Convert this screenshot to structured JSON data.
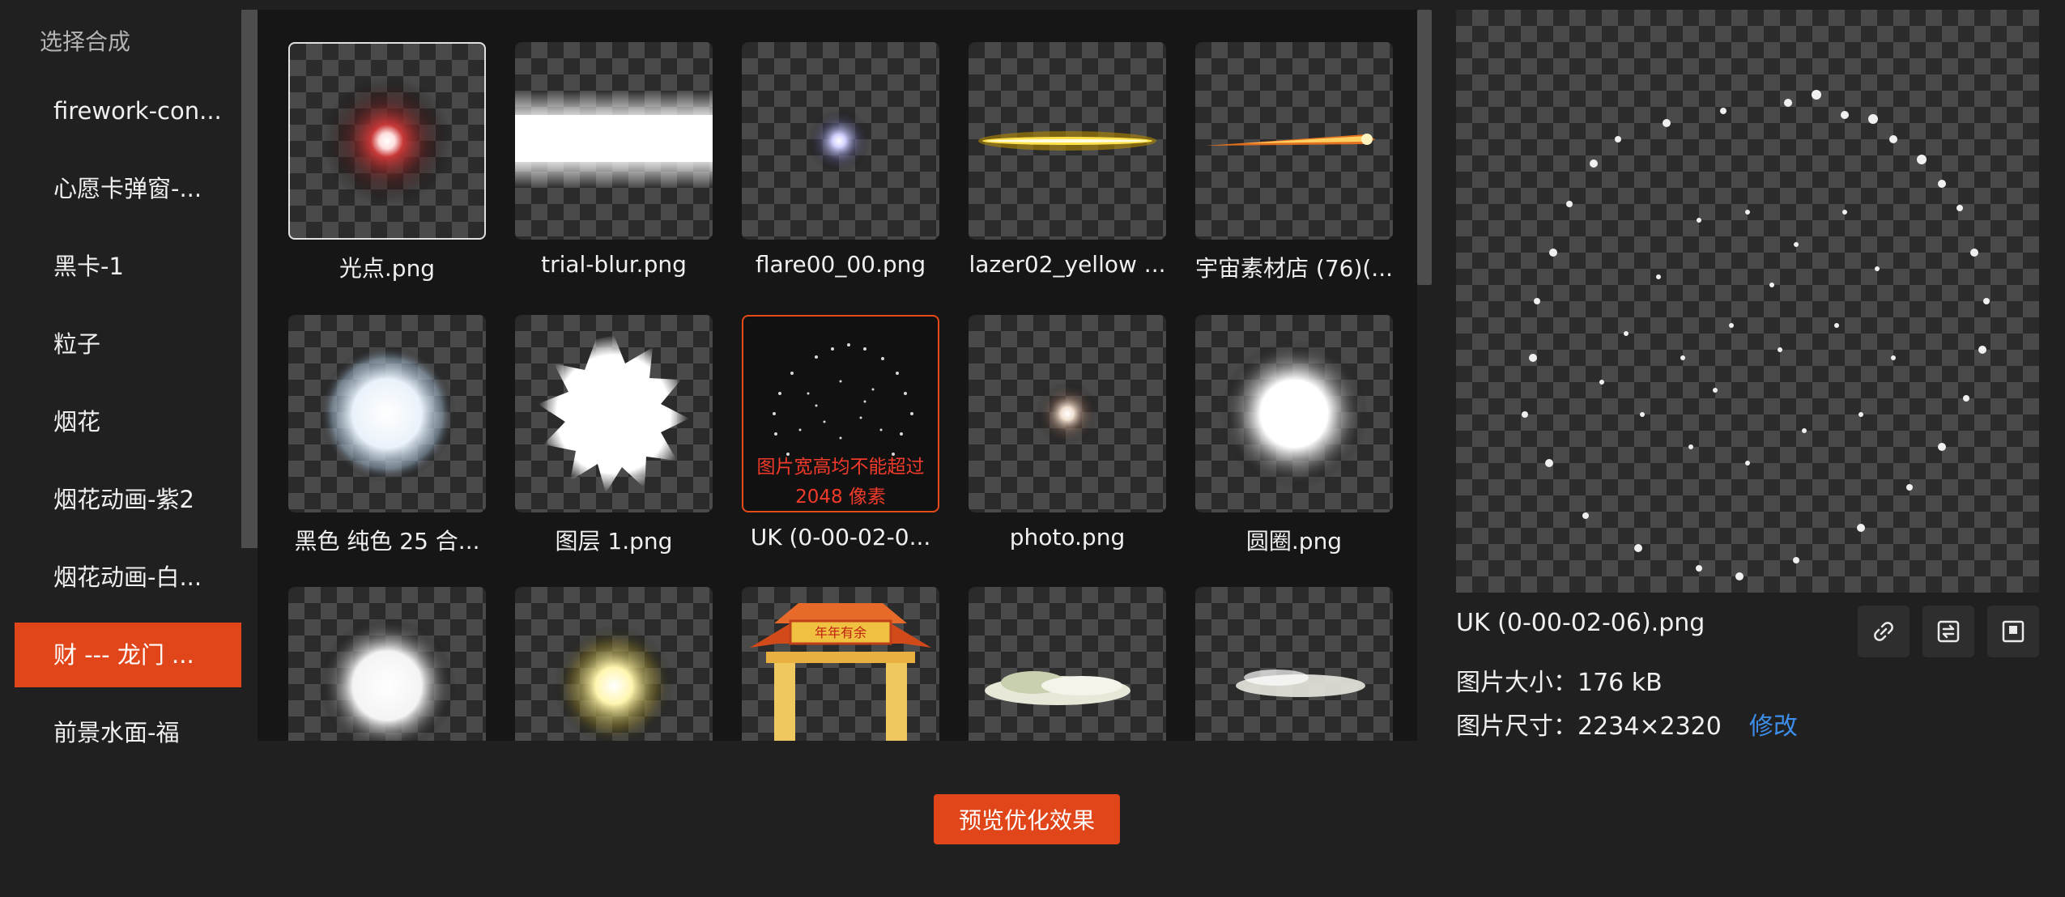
{
  "sidebar": {
    "title": "选择合成",
    "items": [
      {
        "label": "firework-con..."
      },
      {
        "label": "心愿卡弹窗-..."
      },
      {
        "label": "黑卡-1"
      },
      {
        "label": "粒子"
      },
      {
        "label": "烟花"
      },
      {
        "label": "烟花动画-紫2"
      },
      {
        "label": "烟花动画-白..."
      },
      {
        "label": "财 --- 龙门 ..."
      },
      {
        "label": "前景水面-福"
      }
    ]
  },
  "grid": {
    "tiles": [
      {
        "caption": "光点.png"
      },
      {
        "caption": "trial-blur.png"
      },
      {
        "caption": "flare00_00.png"
      },
      {
        "caption": "lazer02_yellow ..."
      },
      {
        "caption": "宇宙素材店 (76)(..."
      },
      {
        "caption": "黑色 纯色 25 合..."
      },
      {
        "caption": "图层 1.png"
      },
      {
        "caption": "UK (0-00-02-0...",
        "warning": "图片宽高均不能超过 2048 像素"
      },
      {
        "caption": "photo.png"
      },
      {
        "caption": "圆圈.png"
      },
      {
        "caption": ""
      },
      {
        "caption": ""
      },
      {
        "caption": "",
        "arch_plaque": "年年有余"
      },
      {
        "caption": ""
      },
      {
        "caption": ""
      }
    ]
  },
  "detail": {
    "file_name": "UK (0-00-02-06).png",
    "size_label": "图片大小：",
    "size_value": "176 kB",
    "dims_label": "图片尺寸：",
    "dims_value": "2234×2320",
    "modify_link": "修改",
    "icons": [
      "link-icon",
      "swap-icon",
      "frame-icon"
    ]
  },
  "footer": {
    "preview_button": "预览优化效果"
  },
  "colors": {
    "accent": "#e0461a",
    "link": "#3d8eea",
    "warning_text": "#f03a2a",
    "background": "#202020",
    "panel": "#161616"
  }
}
